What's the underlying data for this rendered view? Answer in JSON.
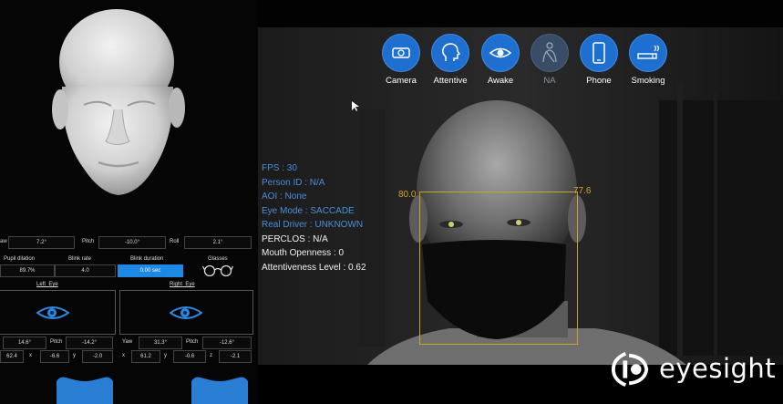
{
  "toolbar": {
    "buttons": [
      {
        "label": "Camera",
        "icon": "camera-icon",
        "state": "active"
      },
      {
        "label": "Attentive",
        "icon": "head-profile-icon",
        "state": "active"
      },
      {
        "label": "Awake",
        "icon": "eye-icon",
        "state": "active"
      },
      {
        "label": "NA",
        "icon": "seatbelt-icon",
        "state": "inactive"
      },
      {
        "label": "Phone",
        "icon": "phone-icon",
        "state": "active"
      },
      {
        "label": "Smoking",
        "icon": "cigarette-icon",
        "state": "active"
      }
    ]
  },
  "status": {
    "fps": "FPS : 30",
    "person_id": "Person ID : N/A",
    "aoi": "AOI : None",
    "eye_mode": "Eye Mode : SACCADE",
    "real_driver": "Real Driver : UNKNOWN",
    "perclos": "PERCLOS : N/A",
    "mouth_openness": "Mouth Openness : 0",
    "attentiveness": "Attentiveness Level : 0.62"
  },
  "face_box": {
    "left_value": "80.0",
    "right_value": "77.6"
  },
  "head_pose": {
    "yaw_label": "aw",
    "yaw_value": "7.2°",
    "pitch_label": "Pitch",
    "pitch_value": "-10.0°",
    "roll_label": "Roll",
    "roll_value": "2.1°"
  },
  "metrics": {
    "pupil_label": "Pupil dilation",
    "pupil_value": "89.7%",
    "blink_rate_label": "Blink rate",
    "blink_rate_value": "4.0",
    "blink_duration_label": "Blink duration",
    "blink_duration_value": "0.00 sec",
    "glasses_label": "Glasses"
  },
  "left_eye": {
    "title": "Left_Eye",
    "yaw": "14.6°",
    "pitch_label": "Pitch",
    "pitch": "-14.2°",
    "x": "62.4",
    "x_label": "x",
    "y": "-6.6",
    "y_label": "y",
    "z": "-2.0"
  },
  "right_eye": {
    "title": "Right_Eye",
    "yaw_label": "Yaw",
    "yaw": "31.3°",
    "pitch_label": "Pitch",
    "pitch": "-12.6°",
    "x_label": "x",
    "x": "61.2",
    "y_label": "y",
    "y": "-0.6",
    "z_label": "z",
    "z": "-2.1"
  },
  "brand": {
    "name": "eyesight"
  },
  "colors": {
    "accent": "#1e6fd0",
    "info_blue": "#4a8ed8",
    "facebox": "#c9a228"
  }
}
